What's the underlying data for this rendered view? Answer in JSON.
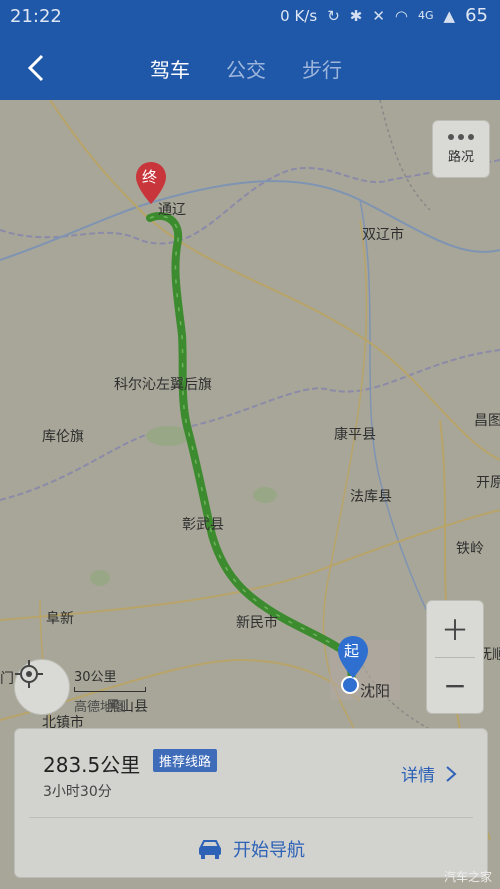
{
  "status_bar": {
    "time": "21:22",
    "data_speed": "0 K/s",
    "signal": "4G",
    "battery": "65"
  },
  "nav": {
    "tabs": [
      {
        "label": "驾车",
        "active": true
      },
      {
        "label": "公交",
        "active": false
      },
      {
        "label": "步行",
        "active": false
      }
    ]
  },
  "map": {
    "road_condition_label": "路况",
    "end_marker_label": "终",
    "start_marker_label": "起",
    "place_labels": [
      "通辽",
      "双辽市",
      "科尔沁左翼后旗",
      "库伦旗",
      "康平县",
      "法库县",
      "彰武县",
      "铁岭",
      "阜新",
      "新民市",
      "沈阳",
      "北镇市",
      "黑山县",
      "昌图",
      "抚顺",
      "开原",
      "门"
    ],
    "scale_label": "30公里",
    "provider_label": "高德地图"
  },
  "route_card": {
    "distance": "283.5公里",
    "badge": "推荐线路",
    "duration": "3小时30分",
    "details_label": "详情",
    "start_navigation_label": "开始导航"
  },
  "watermark": "汽车之家",
  "colors": {
    "header": "#1f58a8",
    "route": "#3d8b2f",
    "accent": "#2d62b7",
    "end_marker": "#c8363b",
    "start_marker": "#2f6fd0"
  }
}
